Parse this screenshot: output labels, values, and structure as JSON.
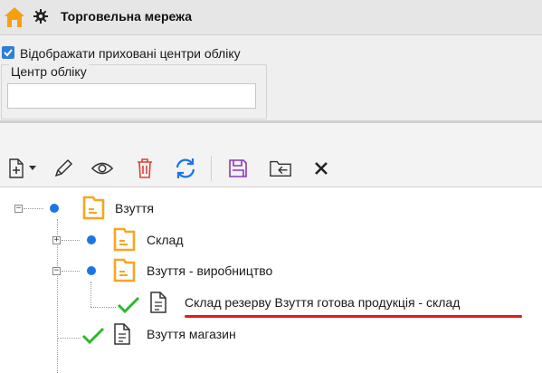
{
  "window": {
    "title": "Торговельна мережа",
    "icons": [
      "home-icon",
      "gear-icon"
    ]
  },
  "filter": {
    "show_hidden_label": "Відображати приховані центри обліку",
    "show_hidden_checked": true,
    "center_label": "Центр обліку",
    "center_value": "",
    "center_placeholder": ""
  },
  "toolbar": {
    "buttons": [
      "add-icon",
      "dropdown-arrow-icon",
      "edit-icon",
      "view-icon",
      "delete-icon",
      "refresh-icon",
      "save-icon",
      "move-folder-icon",
      "close-icon"
    ]
  },
  "tree": {
    "nodes": [
      {
        "label": "Взуття",
        "type": "folder",
        "level": 0,
        "expanded": true
      },
      {
        "label": "Склад",
        "type": "folder",
        "level": 1,
        "expanded": false
      },
      {
        "label": "Взуття - виробництво",
        "type": "folder",
        "level": 1,
        "expanded": true
      },
      {
        "label": "Склад резерву Взуття готова продукція - склад",
        "type": "document",
        "level": 2,
        "checked": true
      },
      {
        "label": "Взуття магазин",
        "type": "document",
        "level": 1,
        "checked": true
      }
    ]
  },
  "colors": {
    "accent_blue": "#1d74e8",
    "folder_orange": "#f5a623",
    "check_green": "#2eb82e",
    "delete_red": "#e0403a",
    "save_purple": "#8a3ab9",
    "highlight_underline": "#e21b1b"
  }
}
